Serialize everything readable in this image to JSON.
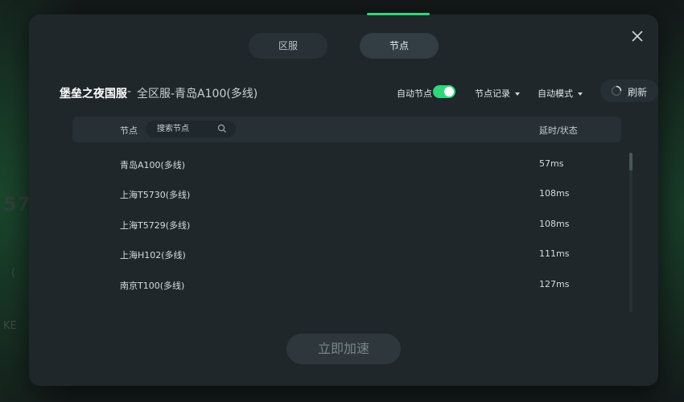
{
  "background": {
    "ghost_number": "57",
    "ghost_text_1": "(",
    "ghost_text_2": "KE"
  },
  "tabs": [
    {
      "label": "区服",
      "active": false
    },
    {
      "label": "节点",
      "active": true
    }
  ],
  "header": {
    "game_name": "堡垒之夜国服",
    "separator": "-",
    "server_path": "全区服-青岛A100(多线)"
  },
  "controls": {
    "auto_node_label": "自动节点",
    "auto_node_on": true,
    "node_history_label": "节点记录",
    "auto_mode_label": "自动模式",
    "refresh_label": "刷新"
  },
  "table": {
    "col_node": "节点",
    "search_placeholder": "搜索节点",
    "col_latency": "延时/状态",
    "rows": [
      {
        "name": "青岛A100(多线)",
        "latency": "57ms"
      },
      {
        "name": "上海T5730(多线)",
        "latency": "108ms"
      },
      {
        "name": "上海T5729(多线)",
        "latency": "108ms"
      },
      {
        "name": "上海H102(多线)",
        "latency": "111ms"
      },
      {
        "name": "南京T100(多线)",
        "latency": "127ms"
      }
    ]
  },
  "footer": {
    "accelerate_label": "立即加速"
  },
  "colors": {
    "accent": "#2fd67a",
    "modal_bg": "#1f272b"
  }
}
